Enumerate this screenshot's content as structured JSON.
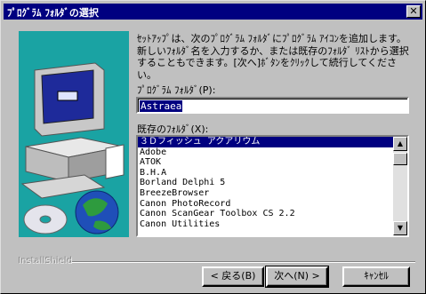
{
  "window": {
    "title": "ﾌﾟﾛｸﾞﾗﾑ ﾌｫﾙﾀﾞの選択",
    "close_glyph": "✕"
  },
  "description": "ｾｯﾄｱｯﾌﾟは、次のﾌﾟﾛｸﾞﾗﾑ ﾌｫﾙﾀﾞにﾌﾟﾛｸﾞﾗﾑ ｱｲｺﾝを追加します。新しいﾌｫﾙﾀﾞ名を入力するか、または既存のﾌｫﾙﾀﾞ ﾘｽﾄから選択することもできます。[次へ]ﾎﾞﾀﾝをｸﾘｯｸして続行してください。",
  "folder_label": "ﾌﾟﾛｸﾞﾗﾑ ﾌｫﾙﾀﾞ(P):",
  "folder_value": "Astraea",
  "existing_label": "既存のﾌｫﾙﾀﾞ(X):",
  "folders": [
    "３Ｄフィッシュ アクアリウム",
    "Adobe",
    "ATOK",
    "B.H.A",
    "Borland Delphi 5",
    "BreezeBrowser",
    "Canon PhotoRecord",
    "Canon ScanGear Toolbox CS 2.2",
    "Canon Utilities"
  ],
  "brand": "InstallShield",
  "buttons": {
    "back": "< 戻る(B)",
    "next": "次へ(N) >",
    "cancel": "ｷｬﾝｾﾙ"
  },
  "scroll": {
    "up": "▲",
    "down": "▼"
  }
}
